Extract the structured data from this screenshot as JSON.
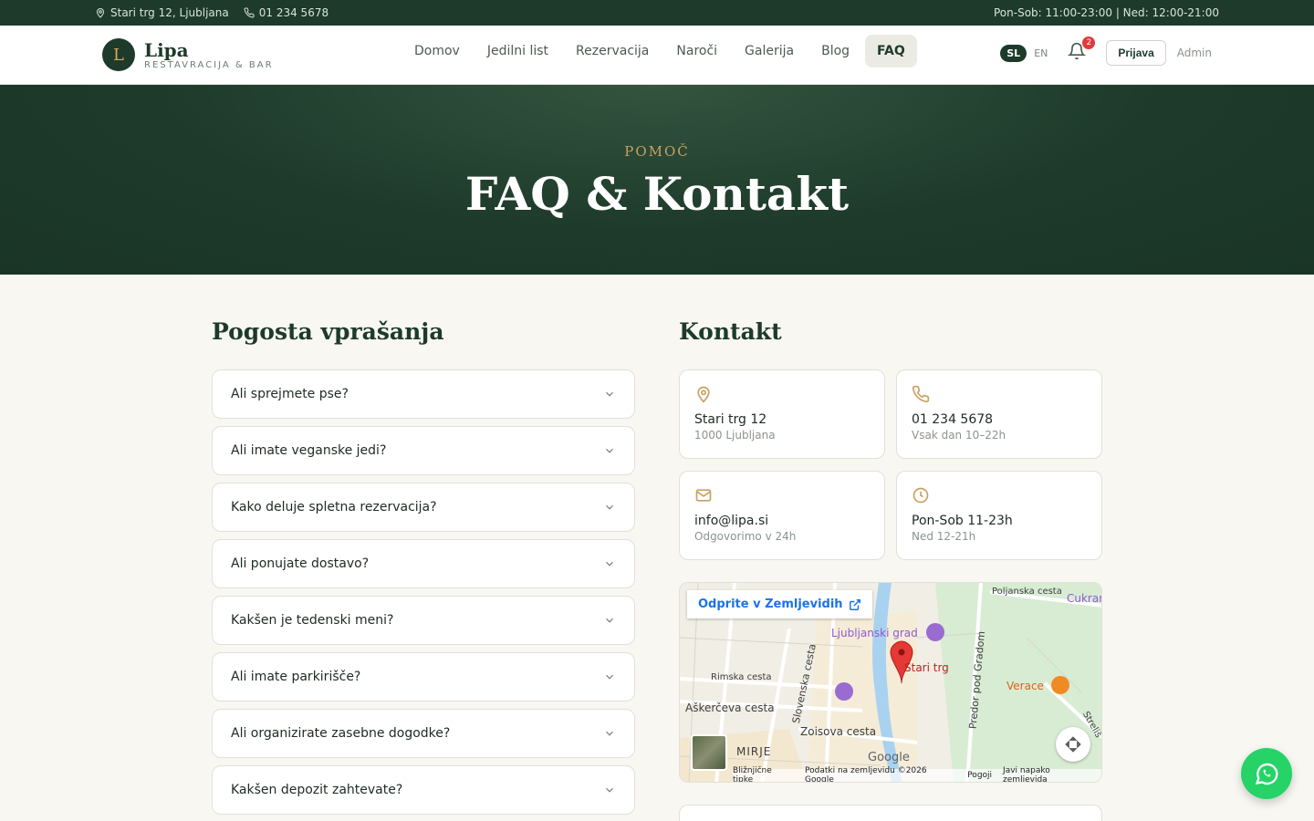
{
  "topbar": {
    "address": "Stari trg 12, Ljubljana",
    "phone": "01 234 5678",
    "hours": "Pon-Sob: 11:00-23:00 | Ned: 12:00-21:00"
  },
  "header": {
    "logo_letter": "L",
    "logo_name": "Lipa",
    "logo_sub": "RESTAVRACIJA & BAR",
    "nav": [
      "Domov",
      "Jedilni list",
      "Rezervacija",
      "Naroči",
      "Galerija",
      "Blog",
      "FAQ"
    ],
    "active_nav": "FAQ",
    "lang_sl": "SL",
    "lang_en": "EN",
    "notification_count": "2",
    "login_label": "Prijava",
    "admin_label": "Admin"
  },
  "hero": {
    "eyebrow": "POMOČ",
    "title": "FAQ & Kontakt"
  },
  "faq": {
    "heading": "Pogosta vprašanja",
    "items": [
      "Ali sprejmete pse?",
      "Ali imate veganske jedi?",
      "Kako deluje spletna rezervacija?",
      "Ali ponujate dostavo?",
      "Kakšen je tedenski meni?",
      "Ali imate parkirišče?",
      "Ali organizirate zasebne dogodke?",
      "Kakšen depozit zahtevate?"
    ]
  },
  "contact": {
    "heading": "Kontakt",
    "cards": [
      {
        "icon": "map-pin-icon",
        "title": "Stari trg 12",
        "sub": "1000 Ljubljana"
      },
      {
        "icon": "phone-icon",
        "title": "01 234 5678",
        "sub": "Vsak dan 10–22h"
      },
      {
        "icon": "mail-icon",
        "title": "info@lipa.si",
        "sub": "Odgovorimo v 24h"
      },
      {
        "icon": "clock-icon",
        "title": "Pon-Sob 11-23h",
        "sub": "Ned 12-21h"
      }
    ]
  },
  "map": {
    "open_label": "Odprite v Zemljevidih",
    "labels": {
      "castle": "Ljubljanski grad",
      "stari_trg": "Stari trg",
      "verace": "Verace",
      "poljanska": "Poljanska cesta",
      "cukr": "Cukrar",
      "rimska": "Rimska cesta",
      "askerceva": "Aškerčeva cesta",
      "slovenska": "Slovenska cesta",
      "zoisova": "Zoisova cesta",
      "mirje": "MIRJE",
      "predor": "Predor pod Gradom",
      "streliska": "Streliš",
      "google": "Google"
    },
    "footer": [
      "Bližnjične tipke",
      "Podatki na zemljevidu ©2026 Google",
      "Pogoji",
      "Javi napako zemljevida"
    ]
  },
  "colors": {
    "brand_dark": "#1d3a2a",
    "accent_gold": "#c9a062",
    "whatsapp": "#25d366"
  }
}
